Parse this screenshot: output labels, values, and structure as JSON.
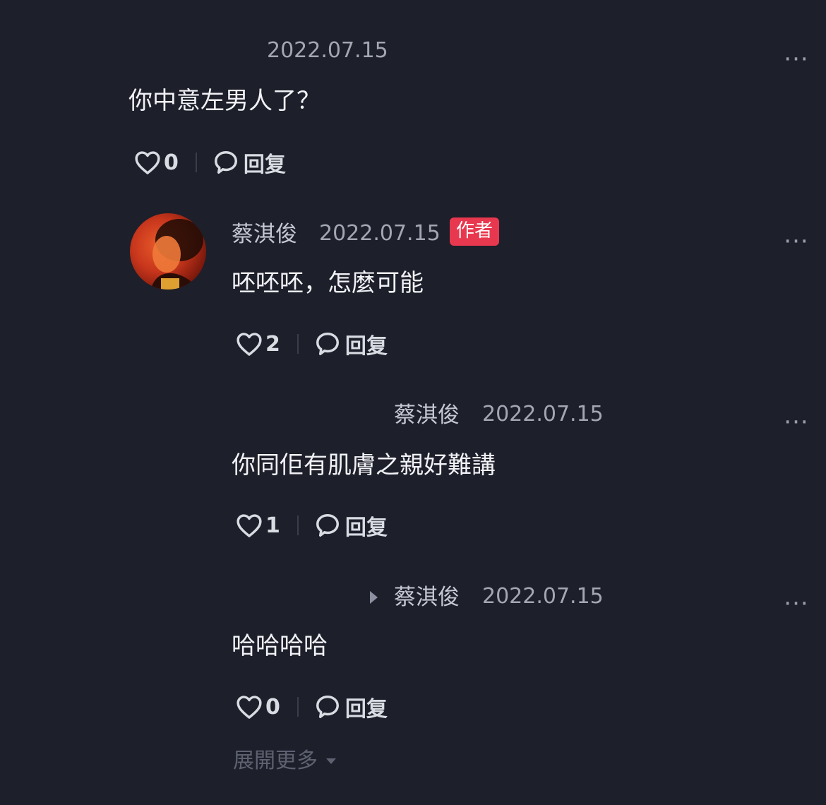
{
  "comments": [
    {
      "date": "2022.07.15",
      "text": "你中意左男人了？",
      "likes": "0",
      "reply_label": "回复",
      "more": "···"
    },
    {
      "author": "蔡淇俊",
      "date": "2022.07.15",
      "badge": "作者",
      "text": "呸呸呸，怎麼可能",
      "likes": "2",
      "reply_label": "回复",
      "more": "···"
    },
    {
      "author": "蔡淇俊",
      "date": "2022.07.15",
      "text": "你同佢有肌膚之親好難講",
      "likes": "1",
      "reply_label": "回复",
      "more": "···"
    },
    {
      "author": "蔡淇俊",
      "date": "2022.07.15",
      "text": "哈哈哈哈",
      "likes": "0",
      "reply_label": "回复",
      "more": "···"
    }
  ],
  "expand_more": "展開更多",
  "colors": {
    "background": "#1d1f2a",
    "author_badge": "#e8384f",
    "secondary_text": "#a3a6b3"
  }
}
